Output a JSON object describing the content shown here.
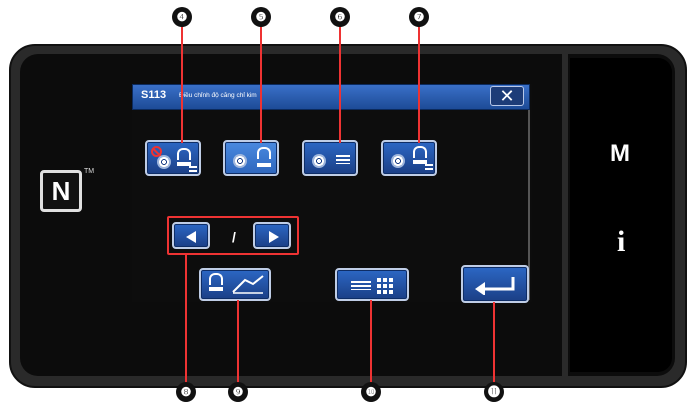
{
  "dialog": {
    "code": "S113",
    "title": "Điều chỉnh độ căng chỉ kim",
    "close_label": "✕"
  },
  "mode_buttons": [
    {
      "name": "mode-button-4",
      "icon": "thread-tension-prohibit-icon",
      "selected": false
    },
    {
      "name": "mode-button-5",
      "icon": "thread-tension-icon",
      "selected": true
    },
    {
      "name": "mode-button-6",
      "icon": "thread-tension-bars-icon",
      "selected": false
    },
    {
      "name": "mode-button-7",
      "icon": "thread-tension-foot-icon",
      "selected": false
    }
  ],
  "pager": {
    "indicator": "/",
    "prev_icon": "arrow-left-icon",
    "next_icon": "arrow-right-icon"
  },
  "function_buttons": [
    {
      "name": "tension-graph-button",
      "icon": "tension-graph-icon"
    },
    {
      "name": "list-grid-button",
      "icon": "list-grid-icon"
    },
    {
      "name": "enter-button",
      "icon": "enter-icon"
    }
  ],
  "side_keys": {
    "m_label": "M",
    "i_label": "i"
  },
  "nfc": {
    "logo_letter": "N",
    "trademark": "TM"
  },
  "callouts": [
    "❹",
    "❺",
    "❻",
    "❼",
    "❽",
    "❾",
    "❿",
    "⓫"
  ],
  "colors": {
    "button_blue": "#2c67c4",
    "selected_blue": "#4a8ae0",
    "title_blue": "#2a5fb8",
    "highlight_red": "#e33333"
  }
}
